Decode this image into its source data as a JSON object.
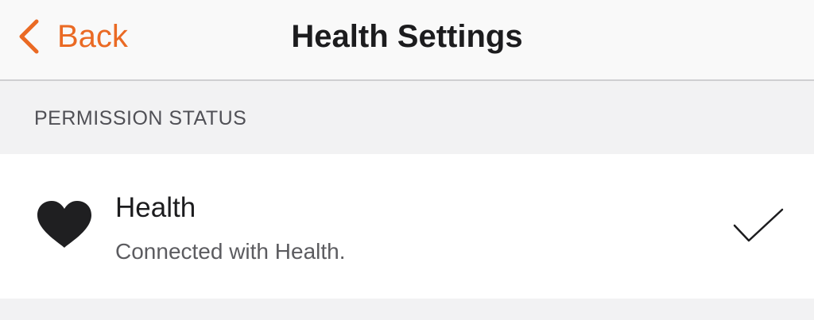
{
  "nav": {
    "back_label": "Back",
    "title": "Health Settings",
    "back_icon": "chevron-left-icon"
  },
  "colors": {
    "accent": "#ea6a24",
    "text_primary": "#1c1c1e",
    "text_secondary": "#5c5c60",
    "grouped_background": "#f2f2f3"
  },
  "section": {
    "title": "PERMISSION STATUS"
  },
  "health_row": {
    "icon": "heart-icon",
    "title": "Health",
    "subtitle": "Connected with Health.",
    "status_icon": "checkmark-icon"
  }
}
